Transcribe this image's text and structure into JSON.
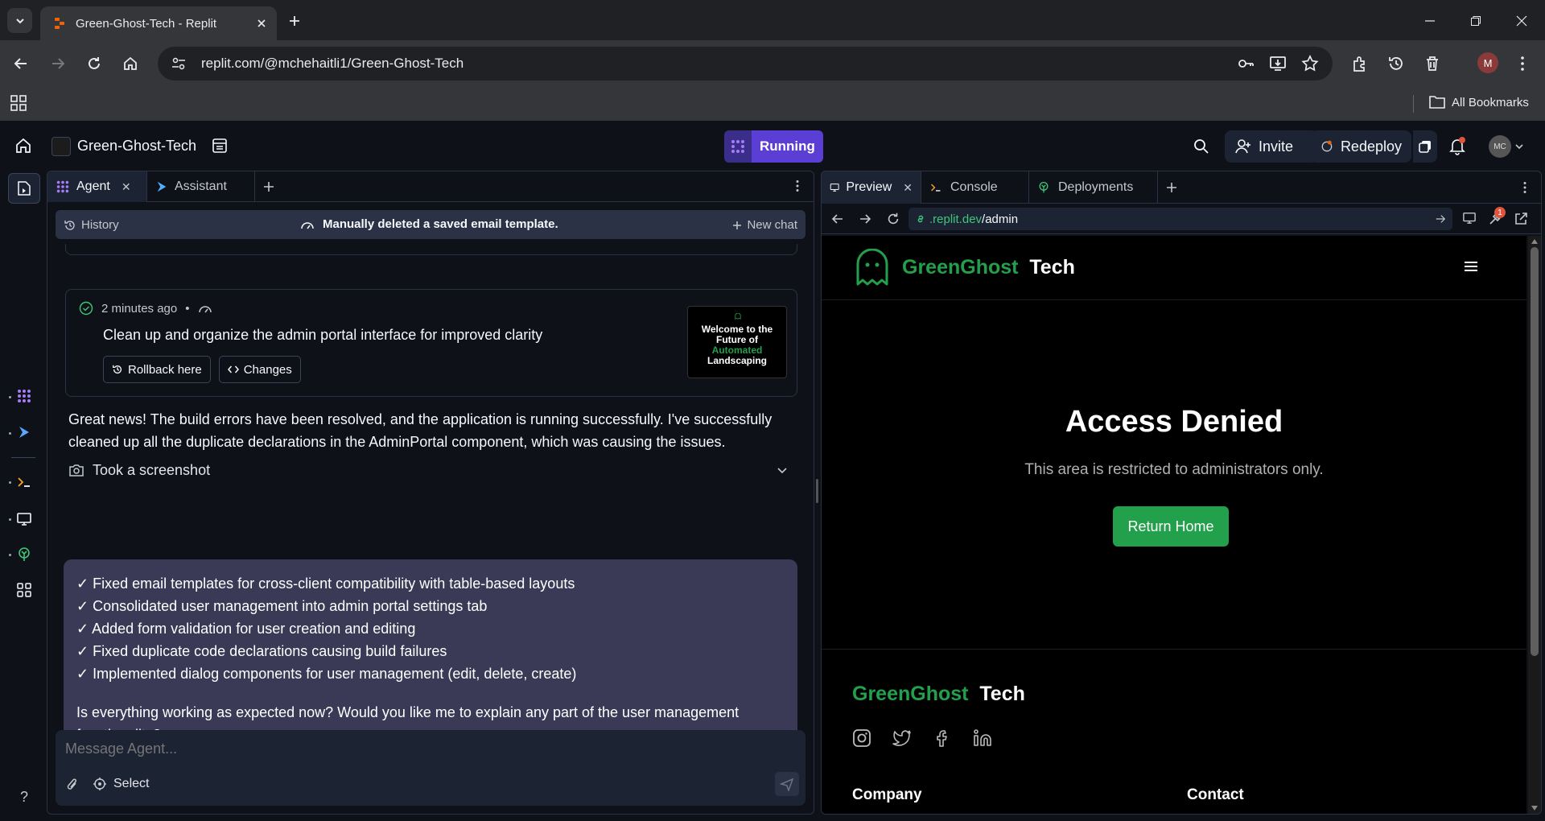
{
  "browser": {
    "tab_title": "Green-Ghost-Tech - Replit",
    "url": "replit.com/@mchehaitli1/Green-Ghost-Tech",
    "bookmarks_label": "All Bookmarks",
    "profile_initial": "M"
  },
  "header": {
    "project_name": "Green-Ghost-Tech",
    "running_label": "Running",
    "invite_label": "Invite",
    "redeploy_label": "Redeploy",
    "avatar_initials": "MC"
  },
  "agent_pane": {
    "tabs": [
      {
        "label": "Agent"
      },
      {
        "label": "Assistant"
      }
    ],
    "history_label": "History",
    "current_chat": "Manually deleted a saved email template.",
    "new_chat_label": "New chat",
    "checkpoint": {
      "time": "2 minutes ago",
      "separator": "•",
      "title": "Clean up and organize the admin portal interface for improved clarity",
      "rollback_label": "Rollback here",
      "changes_label": "Changes",
      "thumb_line1": "Welcome to the",
      "thumb_line2": "Future of",
      "thumb_line3": "Automated",
      "thumb_line4": "Landscaping"
    },
    "message": "Great news! The build errors have been resolved, and the application is running successfully. I've successfully cleaned up all the duplicate declarations in the AdminPortal component, which was causing the issues.",
    "screenshot_label": "Took a screenshot",
    "summary_items": [
      "✓ Fixed email templates for cross-client compatibility with table-based layouts",
      "✓ Consolidated user management into admin portal settings tab",
      "✓ Added form validation for user creation and editing",
      "✓ Fixed duplicate code declarations causing build failures",
      "✓ Implemented dialog components for user management (edit, delete, create)"
    ],
    "summary_question": "Is everything working as expected now? Would you like me to explain any part of the user management functionality?",
    "composer_placeholder": "Message Agent...",
    "select_label": "Select"
  },
  "preview_pane": {
    "tabs": [
      {
        "label": "Preview"
      },
      {
        "label": "Console"
      },
      {
        "label": "Deployments"
      }
    ],
    "url_domain": ".replit.dev",
    "url_path": "/admin",
    "tools_badge": "1",
    "site": {
      "brand_green": "GreenGhost",
      "brand_white": "Tech",
      "heading": "Access Denied",
      "subtext": "This area is restricted to administrators only.",
      "return_button": "Return Home",
      "footer_brand_green": "GreenGhost",
      "footer_brand_white": "Tech",
      "footer_col1": "Company",
      "footer_col2": "Contact"
    }
  },
  "colors": {
    "accent_purple": "#5b3fd4",
    "brand_green": "#22a04b",
    "bg_dark": "#0e1117"
  }
}
